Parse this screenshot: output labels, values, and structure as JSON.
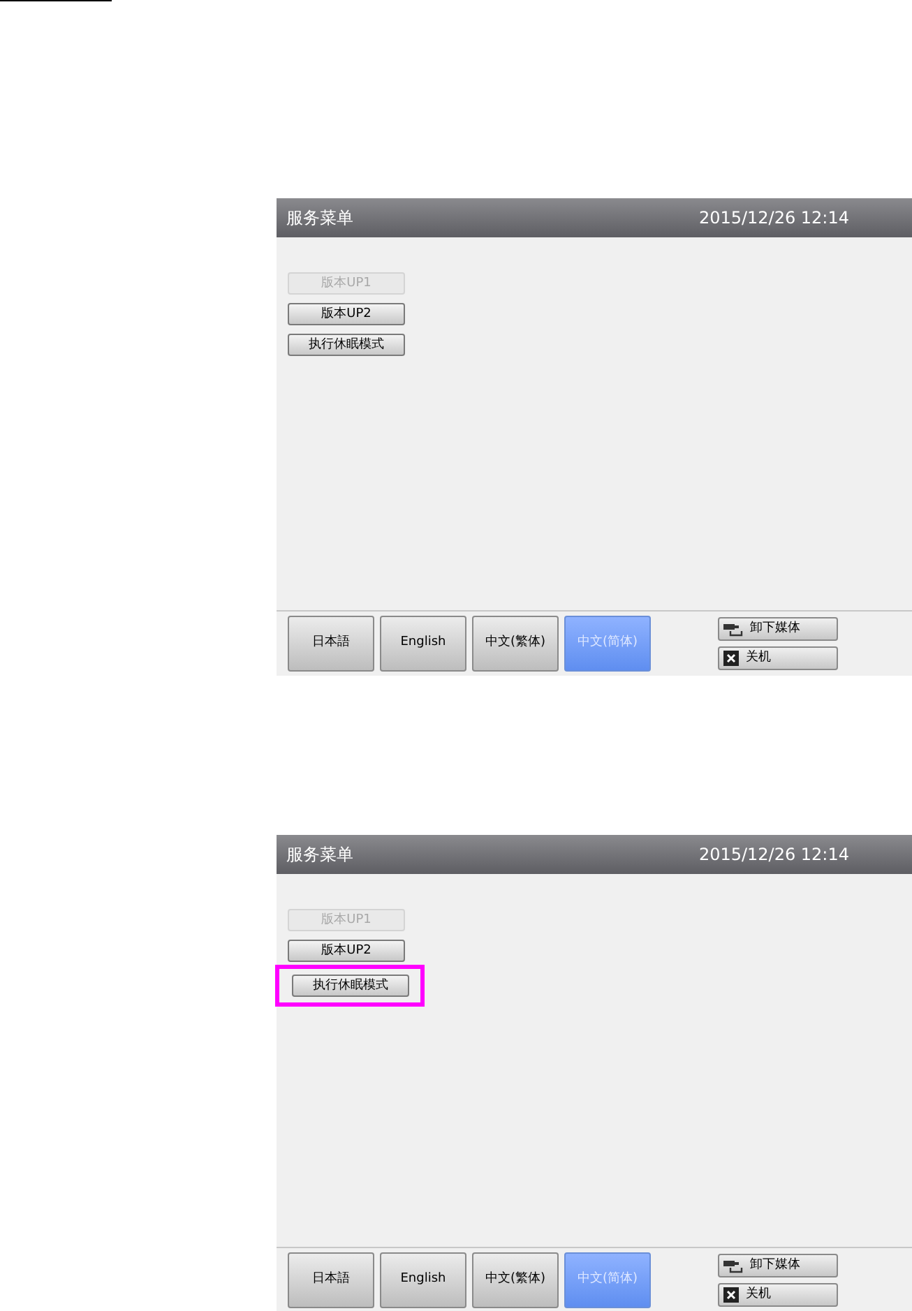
{
  "screens": [
    {
      "title": "服务菜单",
      "datetime": "2015/12/26 12:14",
      "menu_buttons": [
        {
          "label": "版本UP1",
          "disabled": true,
          "highlighted": false
        },
        {
          "label": "版本UP2",
          "disabled": false,
          "highlighted": false
        },
        {
          "label": "执行休眠模式",
          "disabled": false,
          "highlighted": false
        }
      ],
      "language_buttons": [
        {
          "label": "日本語",
          "selected": false
        },
        {
          "label": "English",
          "selected": false
        },
        {
          "label": "中文(繁体)",
          "selected": false
        },
        {
          "label": "中文(简体)",
          "selected": true
        }
      ],
      "action_buttons": [
        {
          "label": "卸下媒体",
          "kind": "media"
        },
        {
          "label": "关机",
          "kind": "shutdown"
        }
      ]
    },
    {
      "title": "服务菜单",
      "datetime": "2015/12/26 12:14",
      "menu_buttons": [
        {
          "label": "版本UP1",
          "disabled": true,
          "highlighted": false
        },
        {
          "label": "版本UP2",
          "disabled": false,
          "highlighted": false
        },
        {
          "label": "执行休眠模式",
          "disabled": false,
          "highlighted": true
        }
      ],
      "language_buttons": [
        {
          "label": "日本語",
          "selected": false
        },
        {
          "label": "English",
          "selected": false
        },
        {
          "label": "中文(繁体)",
          "selected": false
        },
        {
          "label": "中文(简体)",
          "selected": true
        }
      ],
      "action_buttons": [
        {
          "label": "卸下媒体",
          "kind": "media"
        },
        {
          "label": "关机",
          "kind": "shutdown"
        }
      ]
    }
  ]
}
